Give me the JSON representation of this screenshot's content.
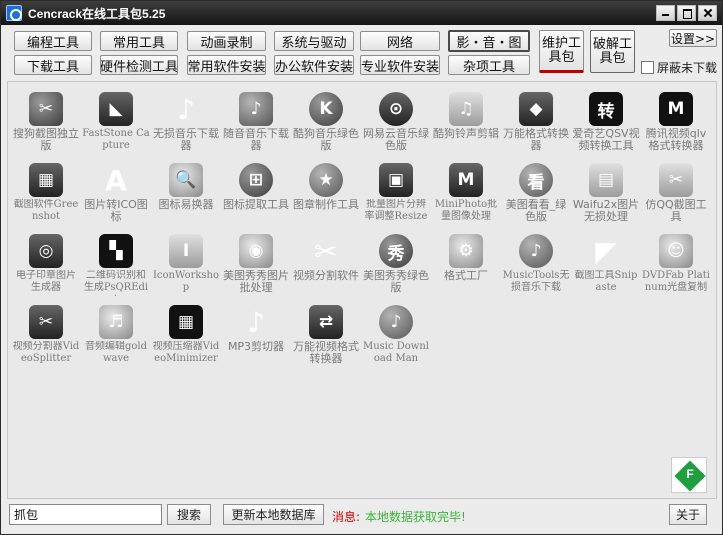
{
  "window": {
    "title": "Cencrack在线工具包5.25"
  },
  "toolbar": {
    "row1": [
      "编程工具",
      "常用工具",
      "动画录制",
      "系统与驱动",
      "网络",
      "影・音・图"
    ],
    "row2": [
      "下载工具",
      "硬件检测工具",
      "常用软件安装",
      "办公软件安装",
      "专业软件安装",
      "杂项工具"
    ],
    "weihu": "维护工具包",
    "pojie": "破解工具包",
    "settings": "设置>>",
    "hide_checkbox": "屏蔽未下载"
  },
  "tools": [
    {
      "label": "搜狗截图独立版",
      "icon": "sogou-screenshot-icon",
      "glyph": "✂"
    },
    {
      "label": "FastStone Capture",
      "icon": "faststone-capture-icon",
      "glyph": "◣"
    },
    {
      "label": "无损音乐下载器",
      "icon": "music-note-icon",
      "glyph": "♪"
    },
    {
      "label": "随音音乐下载器",
      "icon": "music-note-circle-icon",
      "glyph": "♪"
    },
    {
      "label": "酷狗音乐绿色版",
      "icon": "kugou-icon",
      "glyph": "K"
    },
    {
      "label": "网易云音乐绿色版",
      "icon": "netease-music-icon",
      "glyph": "⊙"
    },
    {
      "label": "酷狗铃声剪辑",
      "icon": "ringtone-editor-icon",
      "glyph": "♫"
    },
    {
      "label": "万能格式转换器",
      "icon": "format-converter-icon",
      "glyph": "◆"
    },
    {
      "label": "爱奇艺QSV视频转换工具",
      "icon": "iqiyi-qsv-icon",
      "glyph": "转"
    },
    {
      "label": "腾讯视频qlv格式转换器",
      "icon": "tencent-qlv-icon",
      "glyph": "M"
    },
    {
      "label": "截图软件Greenshot",
      "icon": "greenshot-icon",
      "glyph": "▦"
    },
    {
      "label": "图片转ICO图标",
      "icon": "image-to-ico-icon",
      "glyph": "A"
    },
    {
      "label": "图标易换器",
      "icon": "icon-changer-icon",
      "glyph": "🔍"
    },
    {
      "label": "图标提取工具",
      "icon": "icon-extractor-icon",
      "glyph": "⊞"
    },
    {
      "label": "图章制作工具",
      "icon": "stamp-maker-icon",
      "glyph": "★"
    },
    {
      "label": "批量图片分辨率调整Resize",
      "icon": "batch-resize-icon",
      "glyph": "▣"
    },
    {
      "label": "MiniPhoto批量图像处理",
      "icon": "miniphoto-icon",
      "glyph": "M"
    },
    {
      "label": "美图看看_绿色版",
      "icon": "meitu-viewer-icon",
      "glyph": "看"
    },
    {
      "label": "Waifu2x图片无损处理",
      "icon": "waifu2x-icon",
      "glyph": "▤"
    },
    {
      "label": "仿QQ截图工具",
      "icon": "qq-screenshot-icon",
      "glyph": "✂"
    },
    {
      "label": "电子印章图片生成器",
      "icon": "seal-generator-icon",
      "glyph": "◎"
    },
    {
      "label": "二维码识别和生成PsQREdit",
      "icon": "qrcode-icon",
      "glyph": "▚"
    },
    {
      "label": "IconWorkshop",
      "icon": "iconworkshop-icon",
      "glyph": "I"
    },
    {
      "label": "美图秀秀图片批处理",
      "icon": "meitu-batch-icon",
      "glyph": "◉"
    },
    {
      "label": "视频分割软件",
      "icon": "video-split-icon",
      "glyph": "✂"
    },
    {
      "label": "美图秀秀绿色版",
      "icon": "meitu-xiuxiu-icon",
      "glyph": "秀"
    },
    {
      "label": "格式工厂",
      "icon": "format-factory-icon",
      "glyph": "⚙"
    },
    {
      "label": "MusicTools无损音乐下载",
      "icon": "musictools-icon",
      "glyph": "♪"
    },
    {
      "label": "截图工具Snipaste",
      "icon": "snipaste-icon",
      "glyph": "◤"
    },
    {
      "label": "DVDFab Platinum光盘复制",
      "icon": "dvdfab-icon",
      "glyph": "☺"
    },
    {
      "label": "视频分割器VideoSplitter",
      "icon": "video-splitter-icon",
      "glyph": "✂"
    },
    {
      "label": "音频编辑goldwave",
      "icon": "goldwave-icon",
      "glyph": "♬"
    },
    {
      "label": "视频压缩器VideoMinimizer",
      "icon": "video-minimizer-icon",
      "glyph": "▦"
    },
    {
      "label": "MP3剪切器",
      "icon": "mp3-cutter-icon",
      "glyph": "♪"
    },
    {
      "label": "万能视频格式转换器",
      "icon": "video-converter-icon",
      "glyph": "⇄"
    },
    {
      "label": "Music Download Man",
      "icon": "music-download-icon",
      "glyph": "♪"
    }
  ],
  "bottom": {
    "search_value": "抓包",
    "search_button": "搜索",
    "update_button": "更新本地数据库",
    "msg_label": "消息:",
    "msg_text": "本地数据获取完毕!",
    "about_button": "关于",
    "badge_letter": "F"
  },
  "colors": {
    "titlebar": "#1f1f1f",
    "message_label": "#d40000",
    "message_text": "#3cb33c",
    "badge": "#1f9f3f"
  }
}
